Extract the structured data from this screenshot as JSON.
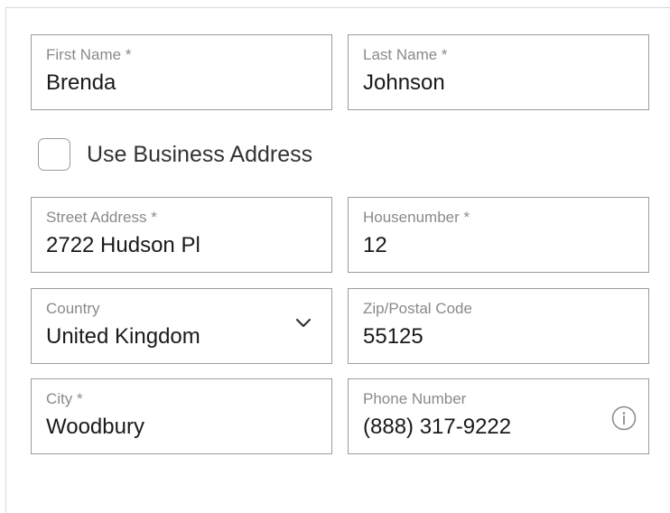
{
  "form": {
    "first_name": {
      "label": "First Name *",
      "value": "Brenda"
    },
    "last_name": {
      "label": "Last Name *",
      "value": "Johnson"
    },
    "use_business_address": {
      "label": "Use Business Address",
      "checked": false
    },
    "street_address": {
      "label": "Street Address *",
      "value": "2722 Hudson Pl"
    },
    "housenumber": {
      "label": "Housenumber *",
      "value": "12"
    },
    "country": {
      "label": "Country",
      "value": "United Kingdom",
      "icon": "chevron-down-icon"
    },
    "zip": {
      "label": "Zip/Postal Code",
      "value": "55125"
    },
    "city": {
      "label": "City *",
      "value": "Woodbury"
    },
    "phone": {
      "label": "Phone Number",
      "value": "(888) 317-9222",
      "icon": "info-icon"
    }
  },
  "colors": {
    "border": "#9c9c9c",
    "label": "#8a8a8a",
    "value": "#1a1a1a"
  }
}
